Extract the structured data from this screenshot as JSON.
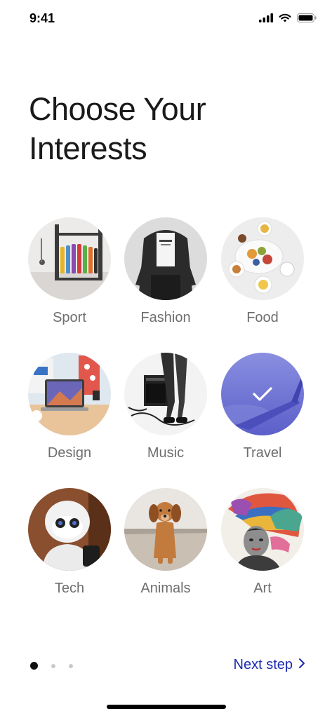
{
  "status_bar": {
    "time": "9:41"
  },
  "header": {
    "title_line1": "Choose Your",
    "title_line2": "Interests"
  },
  "interests": [
    {
      "label": "Sport",
      "selected": false
    },
    {
      "label": "Fashion",
      "selected": false
    },
    {
      "label": "Food",
      "selected": false
    },
    {
      "label": "Design",
      "selected": false
    },
    {
      "label": "Music",
      "selected": false
    },
    {
      "label": "Travel",
      "selected": true
    },
    {
      "label": "Tech",
      "selected": false
    },
    {
      "label": "Animals",
      "selected": false
    },
    {
      "label": "Art",
      "selected": false
    }
  ],
  "pagination": {
    "current_page": 1,
    "total_pages": 3
  },
  "footer": {
    "next_label": "Next step"
  },
  "colors": {
    "accent": "#1c2bb0",
    "selected_overlay": "#6a6fd4",
    "label": "#6e6e6e"
  }
}
